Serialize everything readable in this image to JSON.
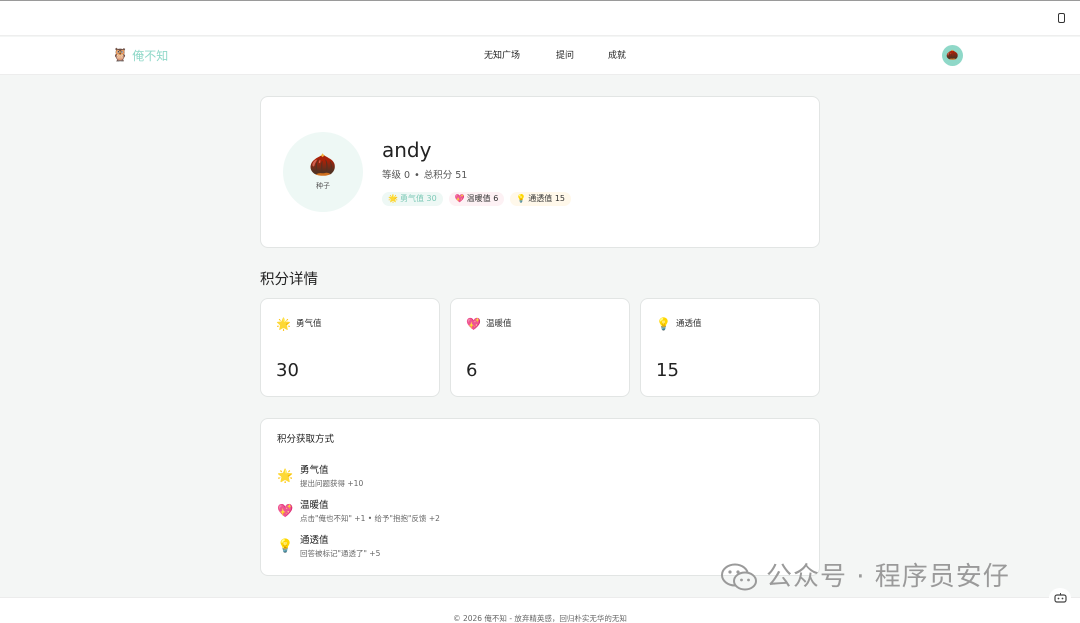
{
  "brand": {
    "name": "俺不知",
    "logo_icon": "🦉"
  },
  "nav": {
    "links": [
      "无知广场",
      "提问",
      "成就"
    ],
    "avatar_icon": "🌰"
  },
  "profile": {
    "avatar_icon": "🌰",
    "level_name": "种子",
    "username": "andy",
    "level": "等级 0",
    "dot": "•",
    "total": "总积分 51",
    "badges": [
      {
        "icon": "🌟",
        "text": "勇气值 30"
      },
      {
        "icon": "💖",
        "text": "温暖值 6"
      },
      {
        "icon": "💡",
        "text": "通透值 15"
      }
    ]
  },
  "details": {
    "title": "积分详情",
    "stats": [
      {
        "icon": "🌟",
        "label": "勇气值",
        "value": "30"
      },
      {
        "icon": "💖",
        "label": "温暖值",
        "value": "6"
      },
      {
        "icon": "💡",
        "label": "通透值",
        "value": "15"
      }
    ]
  },
  "earn": {
    "title": "积分获取方式",
    "rows": [
      {
        "icon": "🌟",
        "name": "勇气值",
        "desc": "提出问题获得 +10"
      },
      {
        "icon": "💖",
        "name": "温暖值",
        "desc": "点击\"俺也不知\" +1 • 给予\"抱抱\"反馈 +2"
      },
      {
        "icon": "💡",
        "name": "通透值",
        "desc": "回答被标记\"通透了\" +5"
      }
    ]
  },
  "footer": {
    "copyright": "© 2026 俺不知 - 放弃精英感，回归朴实无华的无知"
  },
  "watermark": {
    "text": "公众号 · 程序员安仔"
  },
  "colors": {
    "accent": "#8fd8c8",
    "page_bg": "#f4f6f5"
  }
}
